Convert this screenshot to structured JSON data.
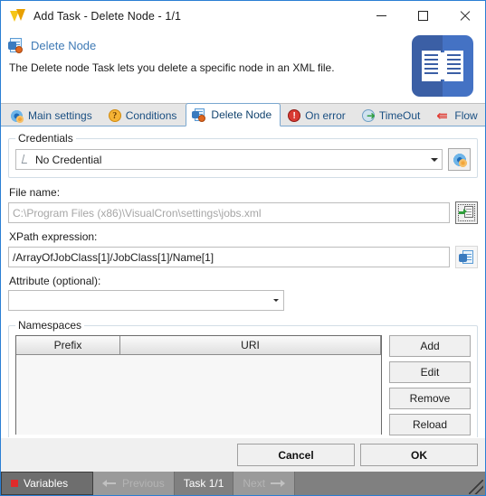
{
  "window": {
    "title": "Add Task - Delete Node - 1/1",
    "icon": "visualcron-logo-icon",
    "minimize_label": "",
    "maximize_label": "",
    "close_label": ""
  },
  "header": {
    "title": "Delete Node",
    "description": "The Delete node Task lets you delete a specific node in an XML file.",
    "icon": "delete-node-icon",
    "side_icon": "book-icon"
  },
  "tabs": [
    {
      "label": "Main settings",
      "icon": "gear-icon",
      "active": false
    },
    {
      "label": "Conditions",
      "icon": "question-icon",
      "active": false
    },
    {
      "label": "Delete Node",
      "icon": "delete-node-icon",
      "active": true
    },
    {
      "label": "On error",
      "icon": "error-icon",
      "active": false
    },
    {
      "label": "TimeOut",
      "icon": "timeout-icon",
      "active": false
    },
    {
      "label": "Flow",
      "icon": "flow-icon",
      "active": false
    }
  ],
  "credentials": {
    "legend": "Credentials",
    "selected": "No Credential",
    "settings_button_icon": "gear-icon"
  },
  "file_name": {
    "label": "File name:",
    "value": "",
    "placeholder": "C:\\Program Files (x86)\\VisualCron\\settings\\jobs.xml",
    "browse_button_icon": "import-file-icon"
  },
  "xpath": {
    "label": "XPath expression:",
    "value": "/ArrayOfJobClass[1]/JobClass[1]/Name[1]",
    "placeholder": "",
    "browse_button_icon": "xml-document-icon"
  },
  "attribute": {
    "label": "Attribute (optional):",
    "value": "",
    "placeholder": ""
  },
  "namespaces": {
    "legend": "Namespaces",
    "columns": [
      "Prefix",
      "URI"
    ],
    "rows": [],
    "buttons": [
      "Add",
      "Edit",
      "Remove",
      "Reload"
    ]
  },
  "footer": {
    "cancel_label": "Cancel",
    "ok_label": "OK"
  },
  "statusbar": {
    "variables_label": "Variables",
    "previous_label": "Previous",
    "task_label": "Task 1/1",
    "next_label": "Next"
  },
  "colors": {
    "window_border": "#2a7fd4",
    "accent_blue": "#3f7ab5",
    "tab_text": "#1a4f82",
    "statusbar_bg": "#808080",
    "variables_dot": "#e02a2a"
  }
}
